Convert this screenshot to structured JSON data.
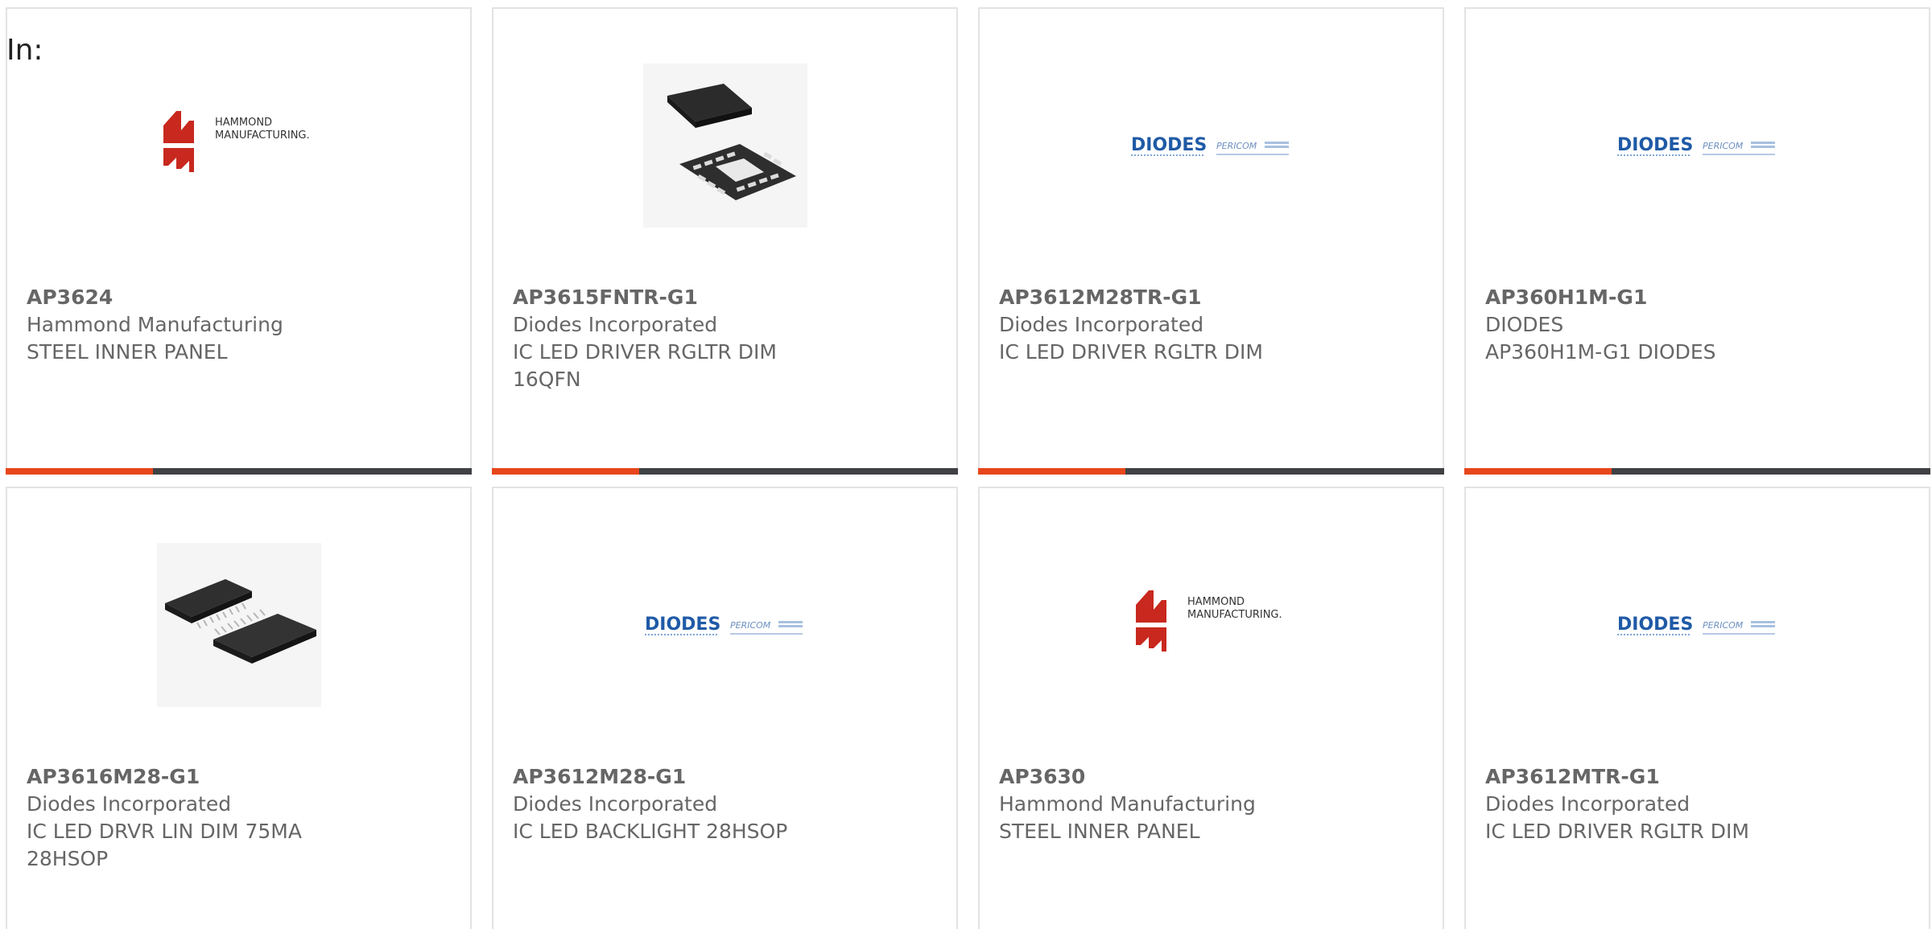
{
  "header": {
    "in_label": "In:"
  },
  "colors": {
    "accent": "#e8461b",
    "bar": "#3f4144",
    "text": "#666666",
    "border": "#e3e3e3"
  },
  "products": [
    {
      "part_number": "AP3624",
      "manufacturer": "Hammond Manufacturing",
      "description": "STEEL INNER PANEL",
      "image": "hammond-logo",
      "show_bar": true,
      "logo_text_1": "HAMMOND",
      "logo_text_2": "MANUFACTURING."
    },
    {
      "part_number": "AP3615FNTR-G1",
      "manufacturer": "Diodes Incorporated",
      "description": "IC LED DRIVER RGLTR DIM 16QFN",
      "image": "qfn-chip-photo",
      "show_bar": true
    },
    {
      "part_number": "AP3612M28TR-G1",
      "manufacturer": "Diodes Incorporated",
      "description": "IC LED DRIVER RGLTR DIM",
      "image": "diodes-pericom-logo",
      "show_bar": true,
      "logo_text_1": "DIODES",
      "logo_text_2": "PERICOM"
    },
    {
      "part_number": "AP360H1M-G1",
      "manufacturer": "DIODES",
      "description": "AP360H1M-G1 DIODES",
      "image": "diodes-pericom-logo",
      "show_bar": true,
      "logo_text_1": "DIODES",
      "logo_text_2": "PERICOM"
    },
    {
      "part_number": "AP3616M28-G1",
      "manufacturer": "Diodes Incorporated",
      "description": "IC LED DRVR LIN DIM 75MA 28HSOP",
      "image": "hsop-chip-photo",
      "show_bar": false
    },
    {
      "part_number": "AP3612M28-G1",
      "manufacturer": "Diodes Incorporated",
      "description": "IC LED BACKLIGHT 28HSOP",
      "image": "diodes-pericom-logo",
      "show_bar": false,
      "logo_text_1": "DIODES",
      "logo_text_2": "PERICOM"
    },
    {
      "part_number": "AP3630",
      "manufacturer": "Hammond Manufacturing",
      "description": "STEEL INNER PANEL",
      "image": "hammond-logo",
      "show_bar": false,
      "logo_text_1": "HAMMOND",
      "logo_text_2": "MANUFACTURING."
    },
    {
      "part_number": "AP3612MTR-G1",
      "manufacturer": "Diodes Incorporated",
      "description": "IC LED DRIVER RGLTR DIM",
      "image": "diodes-pericom-logo",
      "show_bar": false,
      "logo_text_1": "DIODES",
      "logo_text_2": "PERICOM"
    }
  ]
}
